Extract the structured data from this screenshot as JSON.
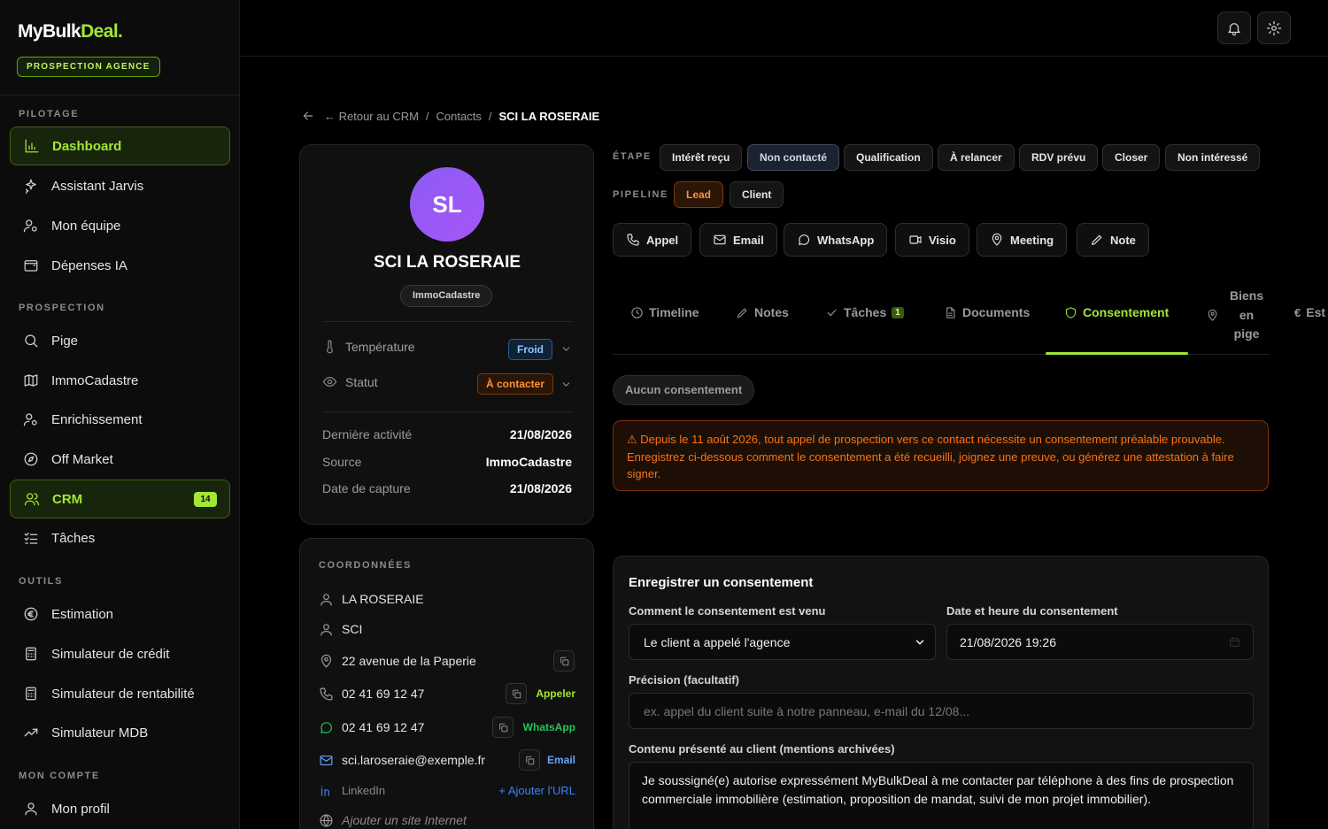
{
  "brand": {
    "name_white": "MyBulk",
    "name_green": "Deal.",
    "badge": "PROSPECTION AGENCE"
  },
  "sidebar": {
    "sections": {
      "pilotage": "PILOTAGE",
      "prospection": "PROSPECTION",
      "outils": "OUTILS",
      "compte": "MON COMPTE"
    },
    "items": [
      {
        "label": "Dashboard",
        "icon": "bar-chart-icon",
        "active": true
      },
      {
        "label": "Assistant Jarvis",
        "icon": "sparkles-icon"
      },
      {
        "label": "Mon équipe",
        "icon": "user-team-icon"
      },
      {
        "label": "Dépenses IA",
        "icon": "wallet-icon"
      },
      {
        "label": "Pige",
        "icon": "search-icon"
      },
      {
        "label": "ImmoCadastre",
        "icon": "map-icon"
      },
      {
        "label": "Enrichissement",
        "icon": "user-gear-icon"
      },
      {
        "label": "Off Market",
        "icon": "compass-icon"
      },
      {
        "label": "CRM",
        "icon": "users-icon",
        "active": true,
        "count": "14"
      },
      {
        "label": "Tâches",
        "icon": "list-check-icon"
      },
      {
        "label": "Estimation",
        "icon": "euro-icon"
      },
      {
        "label": "Simulateur de crédit",
        "icon": "calculator-icon"
      },
      {
        "label": "Simulateur de rentabilité",
        "icon": "calculator-icon"
      },
      {
        "label": "Simulateur MDB",
        "icon": "trend-icon"
      },
      {
        "label": "Mon profil",
        "icon": "user-icon"
      }
    ]
  },
  "breadcrumb": {
    "back": "← Retour au CRM",
    "sep": "/",
    "contacts": "Contacts",
    "current": "SCI LA ROSERAIE"
  },
  "contact": {
    "initials": "SL",
    "name": "SCI LA ROSERAIE",
    "tag": "ImmoCadastre",
    "temperature_label": "Température",
    "temperature_value": "Froid",
    "status_label": "Statut",
    "status_value": "À contacter",
    "last_activity_label": "Dernière activité",
    "last_activity_value": "21/08/2026",
    "source_label": "Source",
    "source_value": "ImmoCadastre",
    "capture_label": "Date de capture",
    "capture_value": "21/08/2026"
  },
  "coords": {
    "title": "COORDONNÉES",
    "name": "LA ROSERAIE",
    "type": "SCI",
    "address": "22 avenue de la Paperie",
    "phone1": "02 41 69 12 47",
    "phone1_action": "Appeler",
    "phone2": "02 41 69 12 47",
    "phone2_action": "WhatsApp",
    "email": "sci.laroseraie@exemple.fr",
    "email_action": "Email",
    "linkedin": "LinkedIn",
    "linkedin_action": "+ Ajouter l'URL",
    "website": "Ajouter un site Internet"
  },
  "stage": {
    "label": "ÉTAPE",
    "options": [
      "Intérêt reçu",
      "Non contacté",
      "Qualification",
      "À relancer",
      "RDV prévu",
      "Closer",
      "Non intéressé"
    ],
    "selected": "Non contacté"
  },
  "pipeline": {
    "label": "PIPELINE",
    "options": [
      "Lead",
      "Client"
    ],
    "selected": "Lead"
  },
  "actions": [
    "Appel",
    "Email",
    "WhatsApp",
    "Visio",
    "Meeting",
    "Note"
  ],
  "tabs": {
    "timeline": "Timeline",
    "notes": "Notes",
    "taches": "Tâches",
    "taches_count": "1",
    "documents": "Documents",
    "consentement": "Consentement",
    "biens1": "Biens",
    "biens2": "en",
    "biens3": "pige",
    "est": "Est",
    "active": "Consentement"
  },
  "consent": {
    "status": "Aucun consentement",
    "warning": "Depuis le 11 août 2026, tout appel de prospection vers ce contact nécessite un consentement préalable prouvable. Enregistrez ci-dessous comment le consentement a été recueilli, joignez une preuve, ou générez une attestation à faire signer.",
    "form_title": "Enregistrer un consentement",
    "how_label": "Comment le consentement est venu",
    "how_value": "Le client a appelé l'agence",
    "date_label": "Date et heure du consentement",
    "date_value": "21/08/2026 19:26",
    "precision_label": "Précision (facultatif)",
    "precision_placeholder": "ex. appel du client suite à notre panneau, e-mail du 12/08...",
    "content_label": "Contenu présenté au client (mentions archivées)",
    "content_value": "Je soussigné(e) autorise expressément MyBulkDeal à me contacter par téléphone à des fins de prospection commerciale immobilière (estimation, proposition de mandat, suivi de mon projet immobilier)."
  },
  "colors": {
    "accent": "#a3e635",
    "warning": "#f97316",
    "avatar": "#8b5cf6"
  }
}
